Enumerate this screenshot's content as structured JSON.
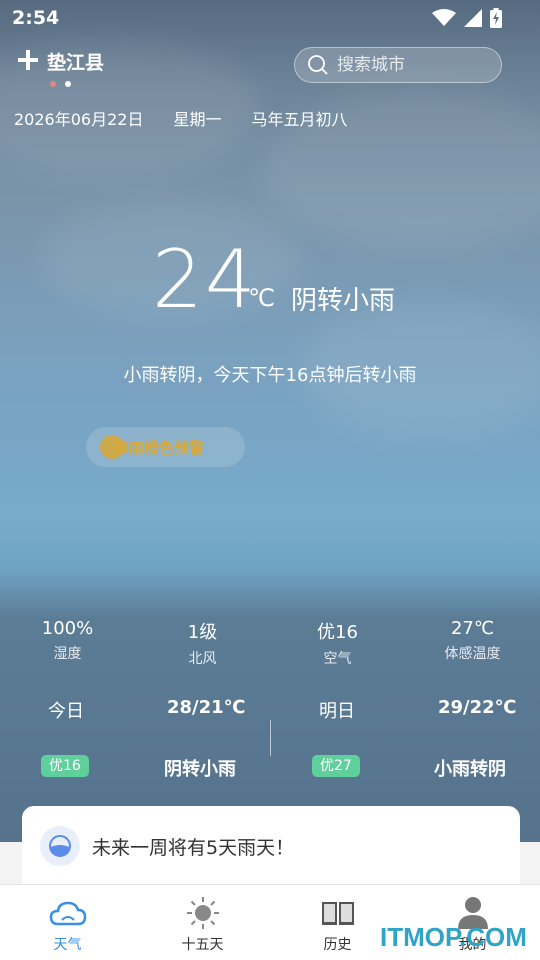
{
  "status_bar": {
    "time": "2:54",
    "icons": [
      "wifi-icon",
      "signal-icon",
      "battery-charging-icon"
    ]
  },
  "header": {
    "add_icon": "plus-icon",
    "city": "垫江县",
    "search_placeholder": "搜索城市",
    "search_icon": "search-icon",
    "page_dots": 2,
    "active_dot": 1
  },
  "date": {
    "solar": "2026年06月22日",
    "weekday": "星期一",
    "lunar": "马年五月初八"
  },
  "current": {
    "temperature": "24",
    "unit": "℃",
    "condition": "阴转小雨",
    "summary": "小雨转阴，今天下午16点钟后转小雨"
  },
  "alert": {
    "label": "暴雨橙色预警",
    "color": "#d9a838"
  },
  "metrics": [
    {
      "value": "100%",
      "label": "湿度"
    },
    {
      "value": "1级",
      "label": "北风"
    },
    {
      "value": "优16",
      "label": "空气"
    },
    {
      "value": "27℃",
      "label": "体感温度"
    }
  ],
  "forecast": {
    "today": {
      "day": "今日",
      "range": "28/21℃",
      "aqi": "优16",
      "condition": "阴转小雨"
    },
    "tomorrow": {
      "day": "明日",
      "range": "29/22℃",
      "aqi": "优27",
      "condition": "小雨转阴"
    }
  },
  "notice": {
    "icon": "raindrop-icon",
    "text": "未来一周将有5天雨天！"
  },
  "tabs": [
    {
      "label": "天气",
      "icon": "cloud-icon",
      "active": true
    },
    {
      "label": "十五天",
      "icon": "sun-icon",
      "active": false
    },
    {
      "label": "历史",
      "icon": "book-icon",
      "active": false
    },
    {
      "label": "我的",
      "icon": "user-icon",
      "active": false
    }
  ],
  "watermark": "ITMOP.COM",
  "colors": {
    "accent": "#3a8ee6",
    "aqi_badge": "#5fcf9c",
    "alert": "#d9a838"
  }
}
